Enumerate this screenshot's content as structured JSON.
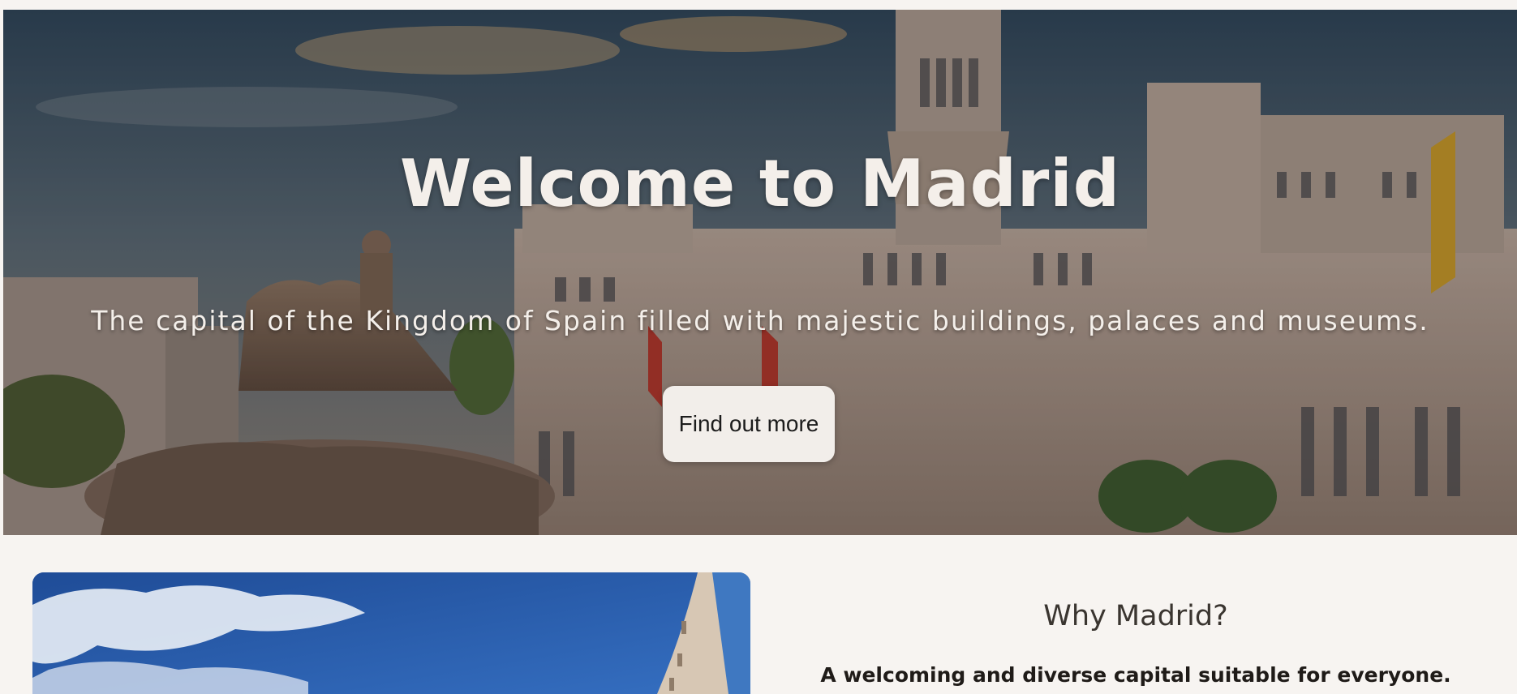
{
  "hero": {
    "title": "Welcome to Madrid",
    "subtitle": "The capital of the Kingdom of Spain filled with majestic buildings, palaces and museums.",
    "button_label": "Find out more"
  },
  "why": {
    "title": "Why Madrid?",
    "text": "A welcoming and diverse capital suitable for everyone."
  },
  "colors": {
    "page_background": "#f7f4f1",
    "hero_text": "#f4efea",
    "button_background": "#f2eeea",
    "sky_blue": "#2b62b3"
  },
  "icons": [
    "hero-background-image",
    "feature-image"
  ]
}
